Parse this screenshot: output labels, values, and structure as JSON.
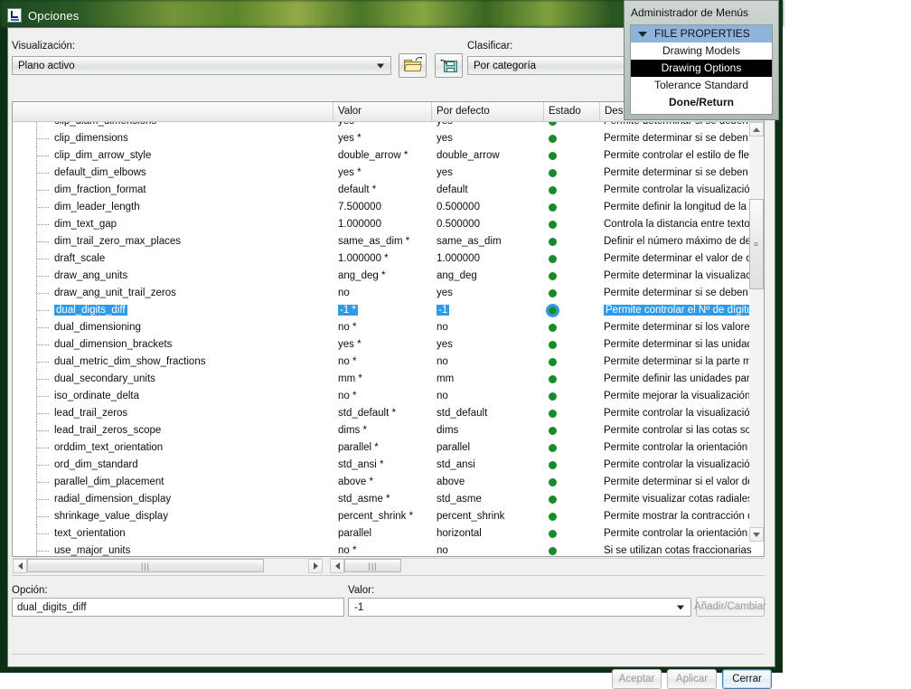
{
  "window": {
    "title": "Opciones",
    "icon": "options-window-icon"
  },
  "toolbar": {
    "display_label": "Visualización:",
    "display_value": "Plano activo",
    "sort_label": "Clasificar:",
    "sort_value": "Por categoría",
    "open_icon": "open-folder-icon",
    "save_icon": "save-file-icon"
  },
  "table": {
    "headers": [
      "",
      "Valor",
      "Por defecto",
      "Estado",
      "Descripción"
    ],
    "rows": [
      {
        "name": "clip_diam_dimensions",
        "value": "yes",
        "star": true,
        "default": "yes",
        "desc": "Permite determinar si se deben recorta",
        "clipped": true
      },
      {
        "name": "clip_dimensions",
        "value": "yes",
        "star": true,
        "default": "yes",
        "desc": "Permite determinar si se deben recorta"
      },
      {
        "name": "clip_dim_arrow_style",
        "value": "double_arrow",
        "star": true,
        "default": "double_arrow",
        "desc": "Permite controlar el estilo de flecha de"
      },
      {
        "name": "default_dim_elbows",
        "value": "yes",
        "star": true,
        "default": "yes",
        "desc": "Permite determinar si se deben mostra"
      },
      {
        "name": "dim_fraction_format",
        "value": "default",
        "star": true,
        "default": "default",
        "desc": "Permite controlar la visualización de c"
      },
      {
        "name": "dim_leader_length",
        "value": "7.500000",
        "star": false,
        "default": "0.500000",
        "desc": "Permite definir la longitud de la línea "
      },
      {
        "name": "dim_text_gap",
        "value": "1.000000",
        "star": false,
        "default": "0.500000",
        "desc": "Controla la distancia entre texto de co"
      },
      {
        "name": "dim_trail_zero_max_places",
        "value": "same_as_dim",
        "star": true,
        "default": "same_as_dim",
        "desc": "Definir el número máximo de decimale"
      },
      {
        "name": "draft_scale",
        "value": "1.000000",
        "star": true,
        "default": "1.000000",
        "desc": "Permite determinar el valor de cotas c"
      },
      {
        "name": "draw_ang_units",
        "value": "ang_deg",
        "star": true,
        "default": "ang_deg",
        "desc": "Permite determinar la visualización de"
      },
      {
        "name": "draw_ang_unit_trail_zeros",
        "value": "no",
        "star": false,
        "default": "yes",
        "desc": "Permite determinar si se deben quitar"
      },
      {
        "name": "dual_digits_diff",
        "value": "-1",
        "star": true,
        "default": "-1",
        "desc": "Permite controlar el Nº de dígitos a la",
        "selected": true
      },
      {
        "name": "dual_dimensioning",
        "value": "no",
        "star": true,
        "default": "no",
        "desc": "Permite determinar si los valores de la"
      },
      {
        "name": "dual_dimension_brackets",
        "value": "yes",
        "star": true,
        "default": "yes",
        "desc": "Permite determinar si las unidades de"
      },
      {
        "name": "dual_metric_dim_show_fractions",
        "value": "no",
        "star": true,
        "default": "no",
        "desc": "Permite determinar si la parte métrica "
      },
      {
        "name": "dual_secondary_units",
        "value": "mm",
        "star": true,
        "default": "mm",
        "desc": "Permite definir las unidades para la vi"
      },
      {
        "name": "iso_ordinate_delta",
        "value": "no",
        "star": true,
        "default": "no",
        "desc": "Permite mejorar la visualización del de"
      },
      {
        "name": "lead_trail_zeros",
        "value": "std_default",
        "star": true,
        "default": "std_default",
        "desc": "Permite controlar la visualización de lo"
      },
      {
        "name": "lead_trail_zeros_scope",
        "value": "dims",
        "star": true,
        "default": "dims",
        "desc": "Permite controlar si las cotas son las u"
      },
      {
        "name": "orddim_text_orientation",
        "value": "parallel",
        "star": true,
        "default": "parallel",
        "desc": "Permite controlar la orientación del te"
      },
      {
        "name": "ord_dim_standard",
        "value": "std_ansi",
        "star": true,
        "default": "std_ansi",
        "desc": "Permite controlar la visualización de c"
      },
      {
        "name": "parallel_dim_placement",
        "value": "above",
        "star": true,
        "default": "above",
        "desc": "Permite determinar si el valor de la co"
      },
      {
        "name": "radial_dimension_display",
        "value": "std_asme",
        "star": true,
        "default": "std_asme",
        "desc": "Permite visualizar cotas radiales con l"
      },
      {
        "name": "shrinkage_value_display",
        "value": "percent_shrink",
        "star": true,
        "default": "percent_shrink",
        "desc": "Permite mostrar la contracción de cot"
      },
      {
        "name": "text_orientation",
        "value": "parallel",
        "star": false,
        "default": "horizontal",
        "desc": "Permite controlar la orientación del te"
      },
      {
        "name": "use_major_units",
        "value": "no",
        "star": true,
        "default": "no",
        "desc": "Si se utilizan cotas fraccionarias y est"
      }
    ]
  },
  "editor": {
    "option_label": "Opción:",
    "option_value": "dual_digits_diff",
    "value_label": "Valor:",
    "value_value": "-1",
    "add_change_label": "Añadir/Cambiar"
  },
  "footer": {
    "ok_label": "Aceptar",
    "apply_label": "Aplicar",
    "close_label": "Cerrar"
  },
  "menu_manager": {
    "title": "Administrador de Menús",
    "items": [
      {
        "label": "FILE PROPERTIES",
        "kind": "header"
      },
      {
        "label": "Drawing Models",
        "kind": "normal"
      },
      {
        "label": "Drawing Options",
        "kind": "selected"
      },
      {
        "label": "Tolerance Standard",
        "kind": "normal"
      },
      {
        "label": "Done/Return",
        "kind": "bold"
      }
    ]
  },
  "colors": {
    "selection": "#2f9be8",
    "status_green": "#1f9c33",
    "menu_header": "#8fb4dc",
    "desktop_green": "#0d2f15"
  }
}
